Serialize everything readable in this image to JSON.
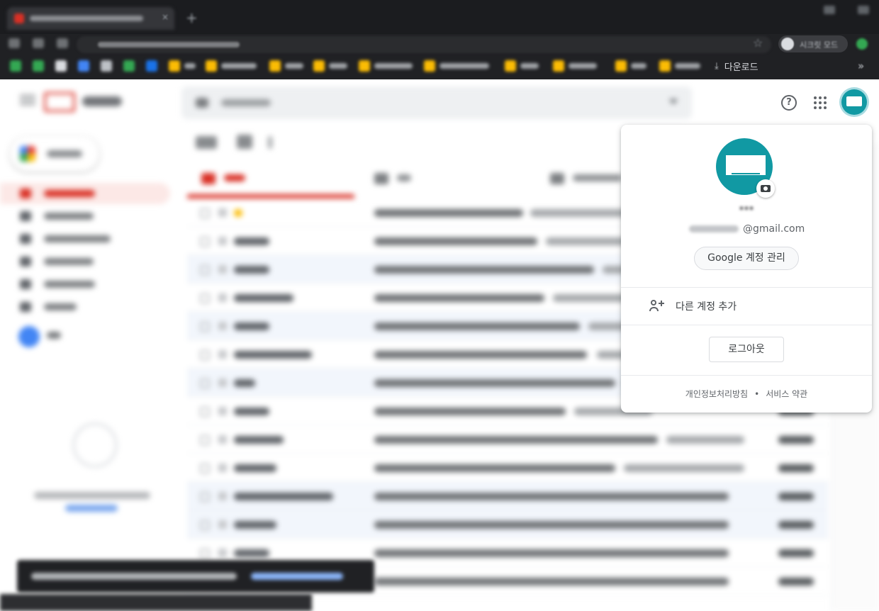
{
  "browser": {
    "incognito_label": "시크릿 모드",
    "downloads_label": "다운로드",
    "more_bookmarks": "»",
    "tab_close": "×",
    "new_tab": "+"
  },
  "header": {
    "help_glyph": "?"
  },
  "account_popup": {
    "name": "***",
    "email_domain": "@gmail.com",
    "manage_button": "Google 계정 관리",
    "add_account": "다른 계정 추가",
    "logout_button": "로그아웃",
    "footer": {
      "privacy": "개인정보처리방침",
      "separator": "•",
      "terms": "서비스 약관"
    }
  },
  "colors": {
    "avatar": "#1199a3",
    "gmail_red": "#d93025",
    "chrome_dark": "#202124"
  },
  "icons": {
    "help": "help-circle-icon",
    "apps": "apps-grid-icon",
    "camera": "camera-icon",
    "person_add": "person-add-icon",
    "download": "download-icon",
    "star": "star-icon"
  }
}
